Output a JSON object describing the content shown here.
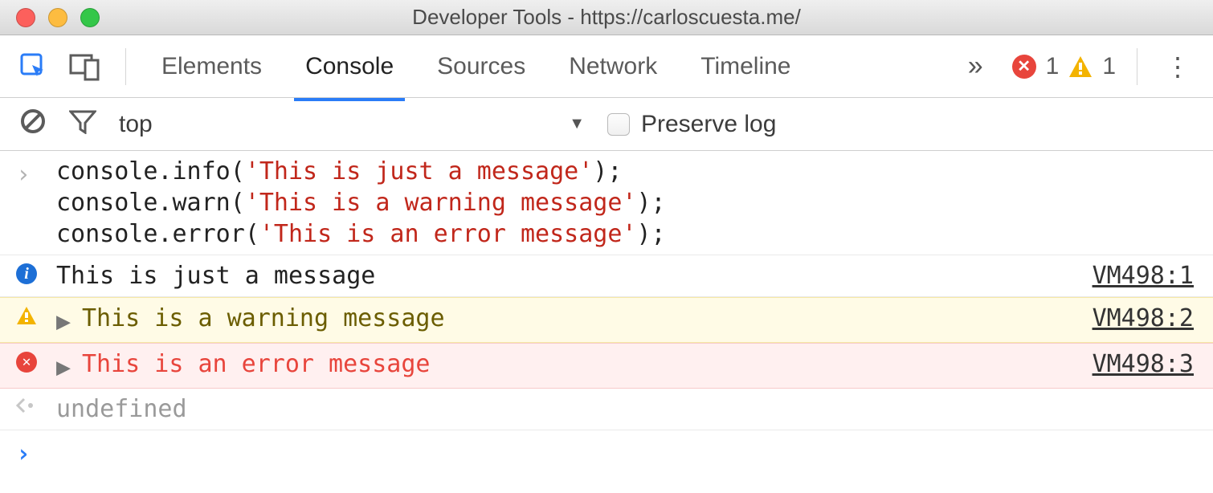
{
  "window": {
    "title": "Developer Tools - https://carloscuesta.me/"
  },
  "tabs": {
    "items": [
      "Elements",
      "Console",
      "Sources",
      "Network",
      "Timeline"
    ],
    "active": "Console",
    "overflow_glyph": "»"
  },
  "status": {
    "error_count": "1",
    "warn_count": "1"
  },
  "filter": {
    "context": "top",
    "preserve_label": "Preserve log"
  },
  "input_block": {
    "lines": [
      {
        "fn": "console.info",
        "open": "(",
        "str": "'This is just a message'",
        "close": ");"
      },
      {
        "fn": "console.warn",
        "open": "(",
        "str": "'This is a warning message'",
        "close": ");"
      },
      {
        "fn": "console.error",
        "open": "(",
        "str": "'This is an error message'",
        "close": ");"
      }
    ]
  },
  "logs": [
    {
      "level": "info",
      "text": "This is just a message",
      "source": "VM498:1"
    },
    {
      "level": "warn",
      "text": "This is a warning message",
      "source": "VM498:2"
    },
    {
      "level": "error",
      "text": "This is an error message",
      "source": "VM498:3"
    }
  ],
  "return_value": "undefined"
}
